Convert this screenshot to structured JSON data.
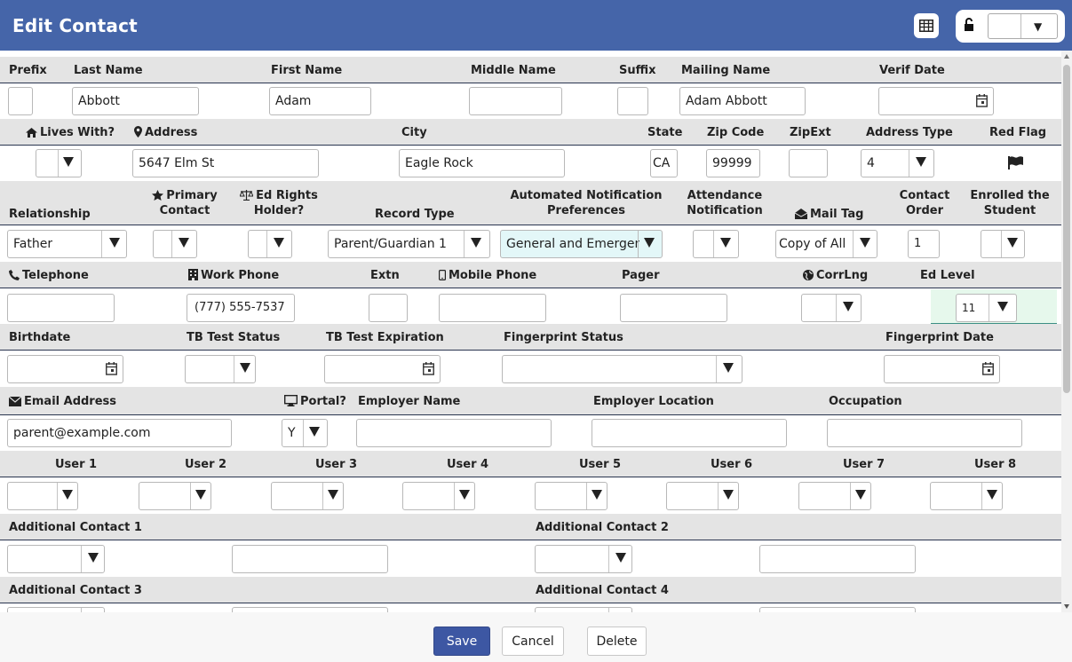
{
  "window": {
    "title": "Edit Contact"
  },
  "row1": {
    "labels": {
      "prefix": "Prefix",
      "last_name": "Last Name",
      "first_name": "First Name",
      "middle_name": "Middle Name",
      "suffix": "Suffix",
      "mailing_name": "Mailing Name",
      "verif_date": "Verif Date"
    },
    "values": {
      "prefix": "",
      "last_name": "Abbott",
      "first_name": "Adam",
      "middle_name": "",
      "suffix": "",
      "mailing_name": "Adam Abbott",
      "verif_date": ""
    }
  },
  "row2": {
    "labels": {
      "lives_with": "Lives With?",
      "address": "Address",
      "city": "City",
      "state": "State",
      "zip": "Zip Code",
      "zipext": "ZipExt",
      "address_type": "Address Type",
      "red_flag": "Red Flag"
    },
    "values": {
      "lives_with": "",
      "address": "5647 Elm St",
      "city": "Eagle Rock",
      "state": "CA",
      "zip": "99999",
      "zipext": "",
      "address_type": "4"
    }
  },
  "row3": {
    "labels": {
      "relationship": "Relationship",
      "primary_1": "Primary",
      "primary_2": "Contact",
      "ed_rights_1": "Ed Rights",
      "ed_rights_2": "Holder?",
      "record_type": "Record Type",
      "auto_notif_1": "Automated Notification",
      "auto_notif_2": "Preferences",
      "attendance_1": "Attendance",
      "attendance_2": "Notification",
      "mail_tag": "Mail Tag",
      "contact_order_1": "Contact",
      "contact_order_2": "Order",
      "enrolled_1": "Enrolled the",
      "enrolled_2": "Student"
    },
    "values": {
      "relationship": "Father",
      "primary": "",
      "ed_rights": "",
      "record_type": "Parent/Guardian 1",
      "auto_notif": "General and Emergency",
      "attendance": "",
      "mail_tag": "Copy of All Mail",
      "contact_order": "1",
      "enrolled": ""
    }
  },
  "row4": {
    "labels": {
      "telephone": "Telephone",
      "work_phone": "Work Phone",
      "extn": "Extn",
      "mobile": "Mobile Phone",
      "pager": "Pager",
      "corrlng": "CorrLng",
      "ed_level": "Ed Level"
    },
    "values": {
      "telephone": "",
      "work_phone": "(777) 555-7537",
      "extn": "",
      "mobile": "",
      "pager": "",
      "corrlng": "",
      "ed_level": "11"
    }
  },
  "row5": {
    "labels": {
      "birthdate": "Birthdate",
      "tb_status": "TB Test Status",
      "tb_exp": "TB Test Expiration",
      "fp_status": "Fingerprint Status",
      "fp_date": "Fingerprint Date"
    },
    "values": {
      "birthdate": "",
      "tb_status": "",
      "tb_exp": "",
      "fp_status": "",
      "fp_date": ""
    }
  },
  "row6": {
    "labels": {
      "email": "Email Address",
      "portal": "Portal?",
      "employer_name": "Employer Name",
      "employer_location": "Employer Location",
      "occupation": "Occupation"
    },
    "values": {
      "email": "parent@example.com",
      "portal": "Y",
      "employer_name": "",
      "employer_location": "",
      "occupation": ""
    }
  },
  "row7": {
    "labels": [
      "User 1",
      "User 2",
      "User 3",
      "User 4",
      "User 5",
      "User 6",
      "User 7",
      "User 8"
    ]
  },
  "row8": {
    "labels": {
      "ac1": "Additional Contact 1",
      "ac2": "Additional Contact 2"
    }
  },
  "row9": {
    "labels": {
      "ac3": "Additional Contact 3",
      "ac4": "Additional Contact 4"
    }
  },
  "footer": {
    "save": "Save",
    "cancel": "Cancel",
    "delete": "Delete"
  },
  "icons": {
    "table": "table-grid-icon",
    "lock": "unlock-icon",
    "calendar": "calendar-icon",
    "home": "home-icon",
    "map": "map-marker-icon",
    "star": "star-icon",
    "scale": "balance-scale-icon",
    "envelope_open": "envelope-open-icon",
    "phone": "phone-icon",
    "building": "building-icon",
    "mobile": "mobile-icon",
    "globe": "globe-icon",
    "envelope": "envelope-icon",
    "desktop": "desktop-icon",
    "flag": "flag-icon"
  },
  "colors": {
    "titlebar": "#4565a9",
    "header_row": "#e4e4e4",
    "primary_button": "#3d57a3",
    "highlight_green": "#e6f8ec",
    "highlight_teal": "#e3f7f8"
  }
}
